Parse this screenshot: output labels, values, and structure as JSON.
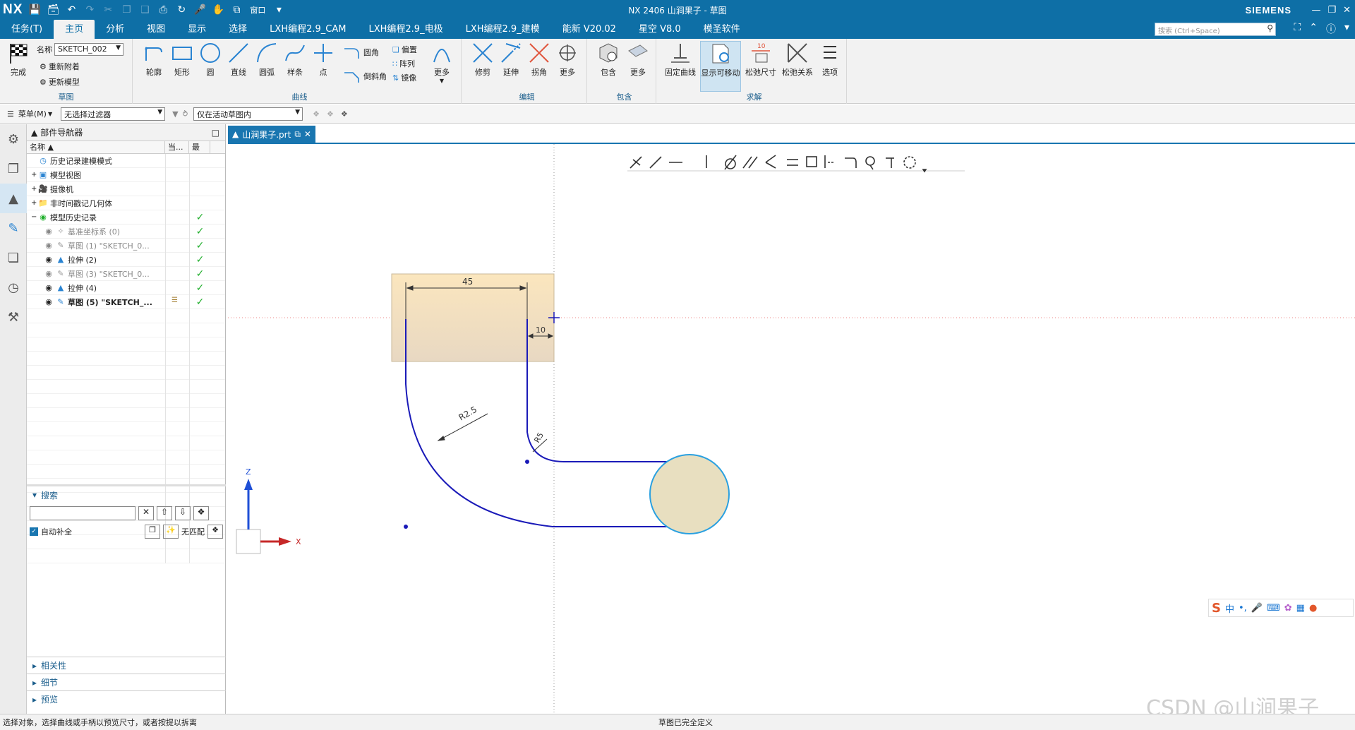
{
  "app": {
    "logo": "NX",
    "window_title": "NX 2406 山涧果子 - 草图",
    "brand": "SIEMENS",
    "window_menu": "窗口"
  },
  "menu": {
    "tabs": [
      "任务(T)",
      "主页",
      "分析",
      "视图",
      "显示",
      "选择",
      "LXH编程2.9_CAM",
      "LXH编程2.9_电极",
      "LXH编程2.9_建模",
      "能新 V20.02",
      "星空 V8.0",
      "模圣软件"
    ],
    "active_index": 1,
    "search_placeholder": "搜索 (Ctrl+Space)"
  },
  "ribbon": {
    "sketch_group": {
      "label": "草图",
      "finish": "完成",
      "name_label": "名称",
      "name_value": "SKETCH_002",
      "reattach": "重新附着",
      "update_model": "更新模型"
    },
    "curve_group": {
      "label": "曲线",
      "buttons": [
        "轮廓",
        "矩形",
        "圆",
        "直线",
        "圆弧",
        "样条",
        "点"
      ],
      "small": [
        "圆角",
        "倒斜角",
        "偏置",
        "阵列",
        "镜像"
      ],
      "more": "更多"
    },
    "edit_group": {
      "label": "编辑",
      "buttons": [
        "修剪",
        "延伸",
        "拐角",
        "更多"
      ]
    },
    "include_group": {
      "label": "包含",
      "buttons": [
        "包含",
        "更多"
      ]
    },
    "solve_group": {
      "label": "求解",
      "buttons": [
        "固定曲线",
        "显示可移动",
        "松弛尺寸",
        "松弛关系",
        "选项"
      ]
    }
  },
  "toolbar2": {
    "menu": "菜单(M)",
    "filter": "无选择过滤器",
    "scope": "仅在活动草图内"
  },
  "navigator": {
    "title": "部件导航器",
    "columns": [
      "名称",
      "当...",
      "最"
    ],
    "rows": [
      {
        "label": "历史记录建模模式",
        "style": "normal",
        "check": false,
        "indent": 1,
        "icon": "history-icon"
      },
      {
        "label": "模型视图",
        "style": "normal",
        "check": false,
        "indent": 1,
        "icon": "views-icon"
      },
      {
        "label": "摄像机",
        "style": "normal",
        "check": false,
        "indent": 1,
        "icon": "camera-icon"
      },
      {
        "label": "非时间戳记几何体",
        "style": "normal",
        "check": false,
        "indent": 1,
        "icon": "folder-icon"
      },
      {
        "label": "模型历史记录",
        "style": "normal",
        "check": true,
        "indent": 1,
        "icon": "history-model-icon"
      },
      {
        "label": "基准坐标系 (0)",
        "style": "gray",
        "check": true,
        "indent": 2,
        "icon": "datum-csys-icon"
      },
      {
        "label": "草图 (1) \"SKETCH_0...",
        "style": "gray",
        "check": true,
        "indent": 2,
        "icon": "sketch-icon"
      },
      {
        "label": "拉伸 (2)",
        "style": "normal",
        "check": true,
        "indent": 2,
        "icon": "extrude-icon"
      },
      {
        "label": "草图 (3) \"SKETCH_0...",
        "style": "gray",
        "check": true,
        "indent": 2,
        "icon": "sketch-icon"
      },
      {
        "label": "拉伸 (4)",
        "style": "normal",
        "check": true,
        "indent": 2,
        "icon": "extrude-icon"
      },
      {
        "label": "草图 (5) \"SKETCH_...",
        "style": "bold",
        "check": true,
        "indent": 2,
        "icon": "sketch-active-icon"
      }
    ],
    "search_title": "搜索",
    "auto_complete": "自动补全",
    "no_match": "无匹配",
    "sections": [
      "相关性",
      "细节",
      "预览"
    ]
  },
  "document": {
    "tab_label": "山涧果子.prt"
  },
  "sketch": {
    "dim_width": "45",
    "dim_offset": "10",
    "dim_r_outer": "R2.5",
    "dim_r_inner": "R5",
    "axis_z": "Z",
    "axis_x": "X"
  },
  "ime": {
    "text": "中"
  },
  "status": {
    "left": "选择对象，选择曲线或手柄以预览尺寸，或者按提以拆离",
    "center": "草图已完全定义"
  },
  "watermark": "CSDN @山涧果子",
  "colors": {
    "titlebar": "#0e6fa6",
    "sketch_curve": "#1a1ab8",
    "fill": "#e8dfc0"
  }
}
